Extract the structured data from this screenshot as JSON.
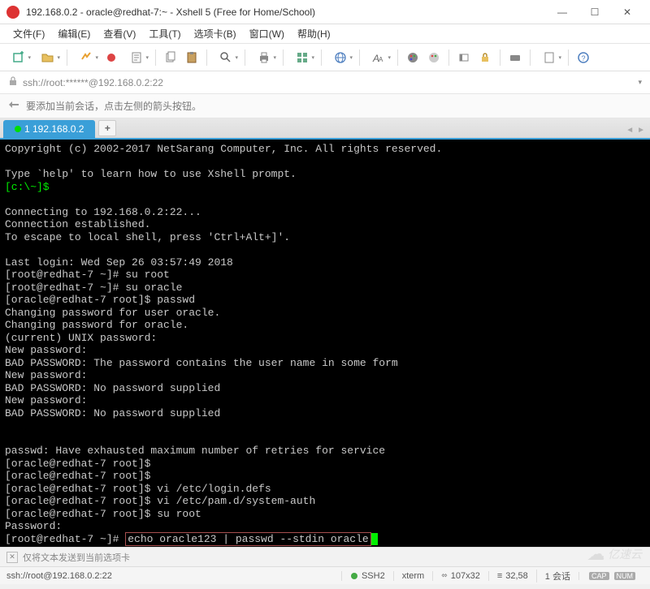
{
  "window": {
    "title": "192.168.0.2 - oracle@redhat-7:~ - Xshell 5 (Free for Home/School)",
    "min": "—",
    "max": "☐",
    "close": "✕"
  },
  "menu": {
    "file": "文件(F)",
    "edit": "编辑(E)",
    "view": "查看(V)",
    "tools": "工具(T)",
    "tab": "选项卡(B)",
    "window": "窗口(W)",
    "help": "帮助(H)"
  },
  "address": {
    "url": "ssh://root:******@192.168.0.2:22"
  },
  "hint": {
    "text": "要添加当前会话，点击左侧的箭头按钮。"
  },
  "tabs": {
    "session": "1 192.168.0.2",
    "add": "+"
  },
  "terminal": {
    "lines": [
      {
        "t": "Copyright (c) 2002-2017 NetSarang Computer, Inc. All rights reserved."
      },
      {
        "t": ""
      },
      {
        "t": "Type `help' to learn how to use Xshell prompt."
      },
      {
        "prompt": "[c:\\~]$",
        "cls": "term-green"
      },
      {
        "t": ""
      },
      {
        "t": "Connecting to 192.168.0.2:22..."
      },
      {
        "t": "Connection established."
      },
      {
        "t": "To escape to local shell, press 'Ctrl+Alt+]'."
      },
      {
        "t": ""
      },
      {
        "t": "Last login: Wed Sep 26 03:57:49 2018"
      },
      {
        "t": "[root@redhat-7 ~]# su root"
      },
      {
        "t": "[root@redhat-7 ~]# su oracle"
      },
      {
        "t": "[oracle@redhat-7 root]$ passwd"
      },
      {
        "t": "Changing password for user oracle."
      },
      {
        "t": "Changing password for oracle."
      },
      {
        "t": "(current) UNIX password:"
      },
      {
        "t": "New password:"
      },
      {
        "t": "BAD PASSWORD: The password contains the user name in some form"
      },
      {
        "t": "New password:"
      },
      {
        "t": "BAD PASSWORD: No password supplied"
      },
      {
        "t": "New password:"
      },
      {
        "t": "BAD PASSWORD: No password supplied"
      },
      {
        "t": ""
      },
      {
        "t": ""
      },
      {
        "t": "passwd: Have exhausted maximum number of retries for service"
      },
      {
        "t": "[oracle@redhat-7 root]$"
      },
      {
        "t": "[oracle@redhat-7 root]$"
      },
      {
        "t": "[oracle@redhat-7 root]$ vi /etc/login.defs"
      },
      {
        "t": "[oracle@redhat-7 root]$ vi /etc/pam.d/system-auth"
      },
      {
        "t": "[oracle@redhat-7 root]$ su root"
      },
      {
        "t": "Password:"
      }
    ],
    "last_prompt": "[root@redhat-7 ~]# ",
    "last_cmd": "echo oracle123 | passwd --stdin oracle"
  },
  "infobar": {
    "text": "仅将文本发送到当前选项卡"
  },
  "statusbar": {
    "conn": "ssh://root@192.168.0.2:22",
    "ssh": "SSH2",
    "term": "xterm",
    "size": "107x32",
    "pos": "32,58",
    "sessions": "1 会话"
  },
  "watermark": {
    "text": "亿速云"
  }
}
